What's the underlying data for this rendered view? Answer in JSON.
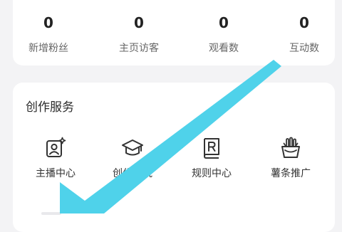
{
  "stats": [
    {
      "value": "0",
      "label": "新增粉丝"
    },
    {
      "value": "0",
      "label": "主页访客"
    },
    {
      "value": "0",
      "label": "观看数"
    },
    {
      "value": "0",
      "label": "互动数"
    }
  ],
  "services": {
    "title": "创作服务",
    "items": [
      {
        "label": "主播中心",
        "icon": "anchor-center-icon"
      },
      {
        "label": "创作学院",
        "icon": "academy-graduation-cap-icon"
      },
      {
        "label": "规则中心",
        "icon": "rules-book-icon"
      },
      {
        "label": "薯条推广",
        "icon": "fries-promotion-icon"
      }
    ]
  },
  "colors": {
    "arrow": "#4fd2ea",
    "icon_stroke": "#333333",
    "background": "#f3f3f5"
  }
}
